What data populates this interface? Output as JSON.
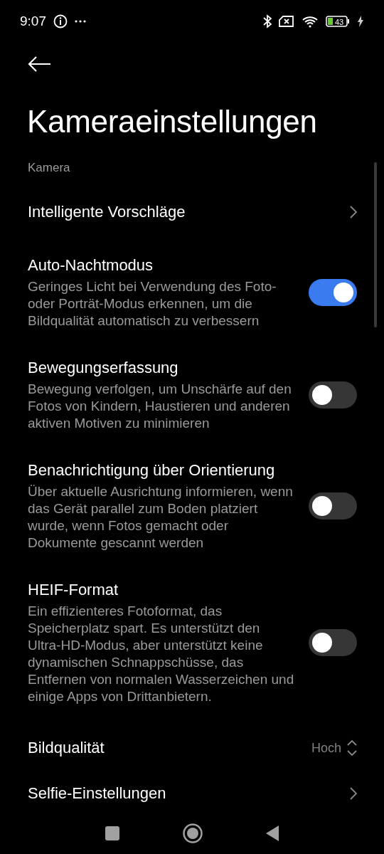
{
  "status_bar": {
    "time": "9:07",
    "battery": "43"
  },
  "title": "Kameraeinstellungen",
  "section": "Kamera",
  "settings": [
    {
      "kind": "link",
      "title": "Intelligente Vorschläge"
    },
    {
      "kind": "toggle",
      "title": "Auto-Nachtmodus",
      "description": "Geringes Licht bei Verwendung des Foto- oder Porträt-Modus erkennen, um die Bildqualität automatisch zu verbessern",
      "on": true
    },
    {
      "kind": "toggle",
      "title": "Bewegungserfassung",
      "description": "Bewegung verfolgen, um Unschärfe auf den Fotos von Kindern, Haustieren und anderen aktiven Motiven zu minimieren",
      "on": false
    },
    {
      "kind": "toggle",
      "title": "Benachrichtigung über Orientierung",
      "description": "Über aktuelle Ausrichtung informieren, wenn das Gerät parallel zum Boden platziert wurde, wenn Fotos gemacht oder Dokumente gescannt werden",
      "on": false
    },
    {
      "kind": "toggle",
      "title": "HEIF-Format",
      "description": "Ein effizienteres Fotoformat, das Speicherplatz spart. Es unterstützt den Ultra-HD-Modus, aber unterstützt keine dynamischen Schnappschüsse, das Entfernen von normalen Wasserzeichen und einige Apps von Drittanbietern.",
      "on": false
    },
    {
      "kind": "value",
      "title": "Bildqualität",
      "value": "Hoch"
    },
    {
      "kind": "link",
      "title": "Selfie-Einstellungen"
    }
  ]
}
